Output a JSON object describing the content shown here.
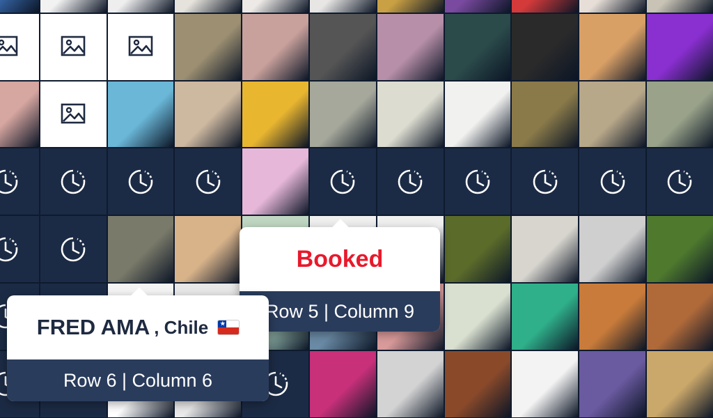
{
  "colors": {
    "booked_bg": "#1c2b45",
    "grid_line": "#0e1a2e",
    "accent_red": "#e8192c"
  },
  "grid": {
    "rows": [
      [
        "art",
        "art",
        "art",
        "art",
        "art",
        "art",
        "art",
        "art",
        "art",
        "art",
        "art"
      ],
      [
        "placeholder",
        "placeholder",
        "placeholder",
        "art",
        "art",
        "art",
        "art",
        "art",
        "art",
        "art",
        "art"
      ],
      [
        "art",
        "placeholder",
        "art",
        "art",
        "art",
        "art",
        "art",
        "art",
        "art",
        "art",
        "art"
      ],
      [
        "booked",
        "booked",
        "booked",
        "booked",
        "art",
        "booked",
        "booked",
        "booked",
        "booked",
        "booked",
        "booked"
      ],
      [
        "booked",
        "booked",
        "art",
        "art",
        "art",
        "art",
        "art",
        "art",
        "art",
        "art",
        "art"
      ],
      [
        "booked",
        "booked",
        "art",
        "art",
        "art",
        "art",
        "art",
        "art",
        "art",
        "art",
        "art"
      ],
      [
        "booked",
        "booked",
        "art",
        "art",
        "booked",
        "art",
        "art",
        "art",
        "art",
        "art",
        "art"
      ]
    ],
    "art_colors": [
      [
        "#3b6fb6",
        "#f2f2f2",
        "#eeeeee",
        "#e6e3dc",
        "#ece9e6",
        "#e7e6e4",
        "#c9a043",
        "#7a4aa0",
        "#d43a3a",
        "#e7dfd7",
        "#c8c3b5"
      ],
      [
        "#ffffff",
        "#ffffff",
        "#ffffff",
        "#9c8f72",
        "#c9a19c",
        "#555555",
        "#b78fa8",
        "#2b4a4a",
        "#2a2a2a",
        "#d9a066",
        "#8a2fd0"
      ],
      [
        "#d6a6a0",
        "#ffffff",
        "#6ab7d8",
        "#cdb8a0",
        "#e9b630",
        "#a5a89b",
        "#dcdcd0",
        "#f1f1ef",
        "#8a7a4a",
        "#b8a88a",
        "#9aa38a"
      ],
      [
        "",
        "",
        "",
        "",
        "#e6b7d8",
        "",
        "",
        "",
        "",
        "",
        ""
      ],
      [
        "",
        "",
        "#7a7a6a",
        "#d8b38a",
        "#bfd7c2",
        "#efefef",
        "#f0f0f0",
        "#5b6b2a",
        "#d7d5ce",
        "#cfcfcf",
        "#4f7a2e"
      ],
      [
        "",
        "",
        "#f4f4f4",
        "#e8e8e8",
        "#9ec3b5",
        "#6a8aa5",
        "#d99a9a",
        "#d9e0d0",
        "#2fb08a",
        "#c87b3a",
        "#b06a3a"
      ],
      [
        "",
        "",
        "#ffffff",
        "#eaeaea",
        "",
        "#c8307a",
        "#d3d3d3",
        "#8a4a2a",
        "#f3f3f3",
        "#6a5aa0",
        "#caa76a"
      ]
    ]
  },
  "tooltips": {
    "booked": {
      "title": "Booked",
      "footer": "Row 5 | Column 9"
    },
    "artist": {
      "name": "FRED AMA",
      "country": ", Chile",
      "flag_icon": "chile-flag-icon",
      "footer": "Row 6 | Column 6"
    }
  },
  "icons": {
    "placeholder": "image-placeholder-icon",
    "booked": "clock-history-icon"
  }
}
